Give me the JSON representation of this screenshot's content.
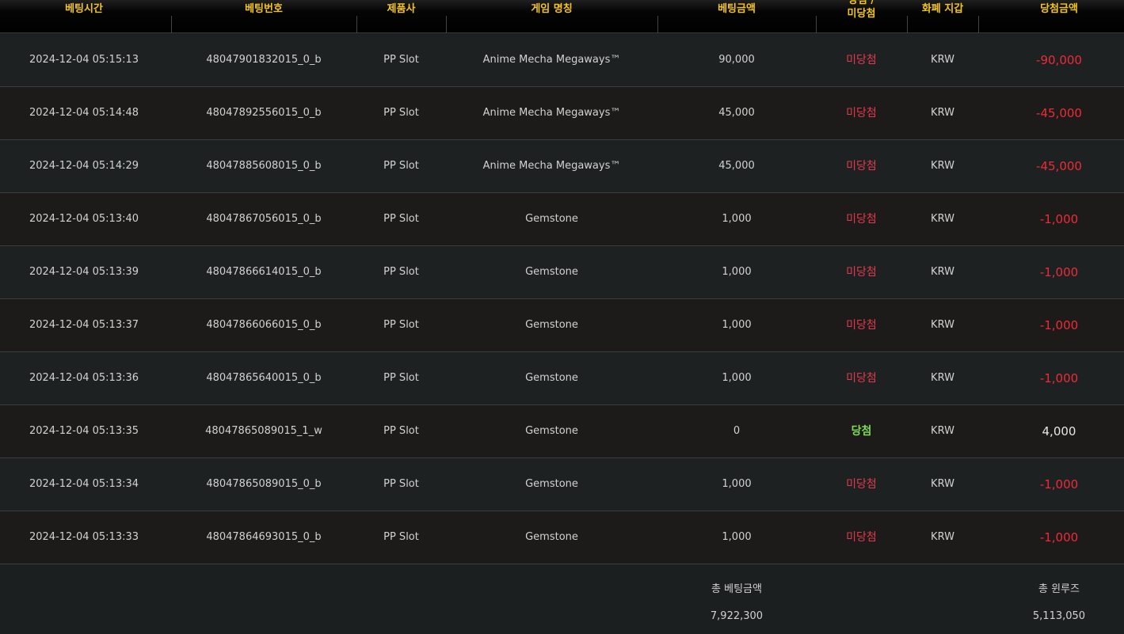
{
  "headers": {
    "bet_time": "베팅시간",
    "bet_number": "베팅번호",
    "provider": "제품사",
    "game_name": "게임 명칭",
    "bet_amount": "베팅금액",
    "result_line1": "당첨 /",
    "result_line2": "미당첨",
    "currency_wallet": "화폐 지갑",
    "win_amount": "당첨금액"
  },
  "colors": {
    "header_text": "#f5c518",
    "lose": "#e23a4c",
    "win": "#7ed957",
    "negative_amount": "#ee2b37"
  },
  "rows": [
    {
      "time": "2024-12-04 05:15:13",
      "bet_id": "48047901832015_0_b",
      "provider": "PP Slot",
      "game": "Anime Mecha Megaways™",
      "bet": "90,000",
      "result": "미당첨",
      "currency": "KRW",
      "amount": "-90,000"
    },
    {
      "time": "2024-12-04 05:14:48",
      "bet_id": "48047892556015_0_b",
      "provider": "PP Slot",
      "game": "Anime Mecha Megaways™",
      "bet": "45,000",
      "result": "미당첨",
      "currency": "KRW",
      "amount": "-45,000"
    },
    {
      "time": "2024-12-04 05:14:29",
      "bet_id": "48047885608015_0_b",
      "provider": "PP Slot",
      "game": "Anime Mecha Megaways™",
      "bet": "45,000",
      "result": "미당첨",
      "currency": "KRW",
      "amount": "-45,000"
    },
    {
      "time": "2024-12-04 05:13:40",
      "bet_id": "48047867056015_0_b",
      "provider": "PP Slot",
      "game": "Gemstone",
      "bet": "1,000",
      "result": "미당첨",
      "currency": "KRW",
      "amount": "-1,000"
    },
    {
      "time": "2024-12-04 05:13:39",
      "bet_id": "48047866614015_0_b",
      "provider": "PP Slot",
      "game": "Gemstone",
      "bet": "1,000",
      "result": "미당첨",
      "currency": "KRW",
      "amount": "-1,000"
    },
    {
      "time": "2024-12-04 05:13:37",
      "bet_id": "48047866066015_0_b",
      "provider": "PP Slot",
      "game": "Gemstone",
      "bet": "1,000",
      "result": "미당첨",
      "currency": "KRW",
      "amount": "-1,000"
    },
    {
      "time": "2024-12-04 05:13:36",
      "bet_id": "48047865640015_0_b",
      "provider": "PP Slot",
      "game": "Gemstone",
      "bet": "1,000",
      "result": "미당첨",
      "currency": "KRW",
      "amount": "-1,000"
    },
    {
      "time": "2024-12-04 05:13:35",
      "bet_id": "48047865089015_1_w",
      "provider": "PP Slot",
      "game": "Gemstone",
      "bet": "0",
      "result": "당첨",
      "currency": "KRW",
      "amount": "4,000"
    },
    {
      "time": "2024-12-04 05:13:34",
      "bet_id": "48047865089015_0_b",
      "provider": "PP Slot",
      "game": "Gemstone",
      "bet": "1,000",
      "result": "미당첨",
      "currency": "KRW",
      "amount": "-1,000"
    },
    {
      "time": "2024-12-04 05:13:33",
      "bet_id": "48047864693015_0_b",
      "provider": "PP Slot",
      "game": "Gemstone",
      "bet": "1,000",
      "result": "미당첨",
      "currency": "KRW",
      "amount": "-1,000"
    }
  ],
  "footer": {
    "total_bet_label": "총 베팅금액",
    "total_bet_value": "7,922,300",
    "total_winloss_label": "총 윈루즈",
    "total_winloss_value": "5,113,050"
  }
}
